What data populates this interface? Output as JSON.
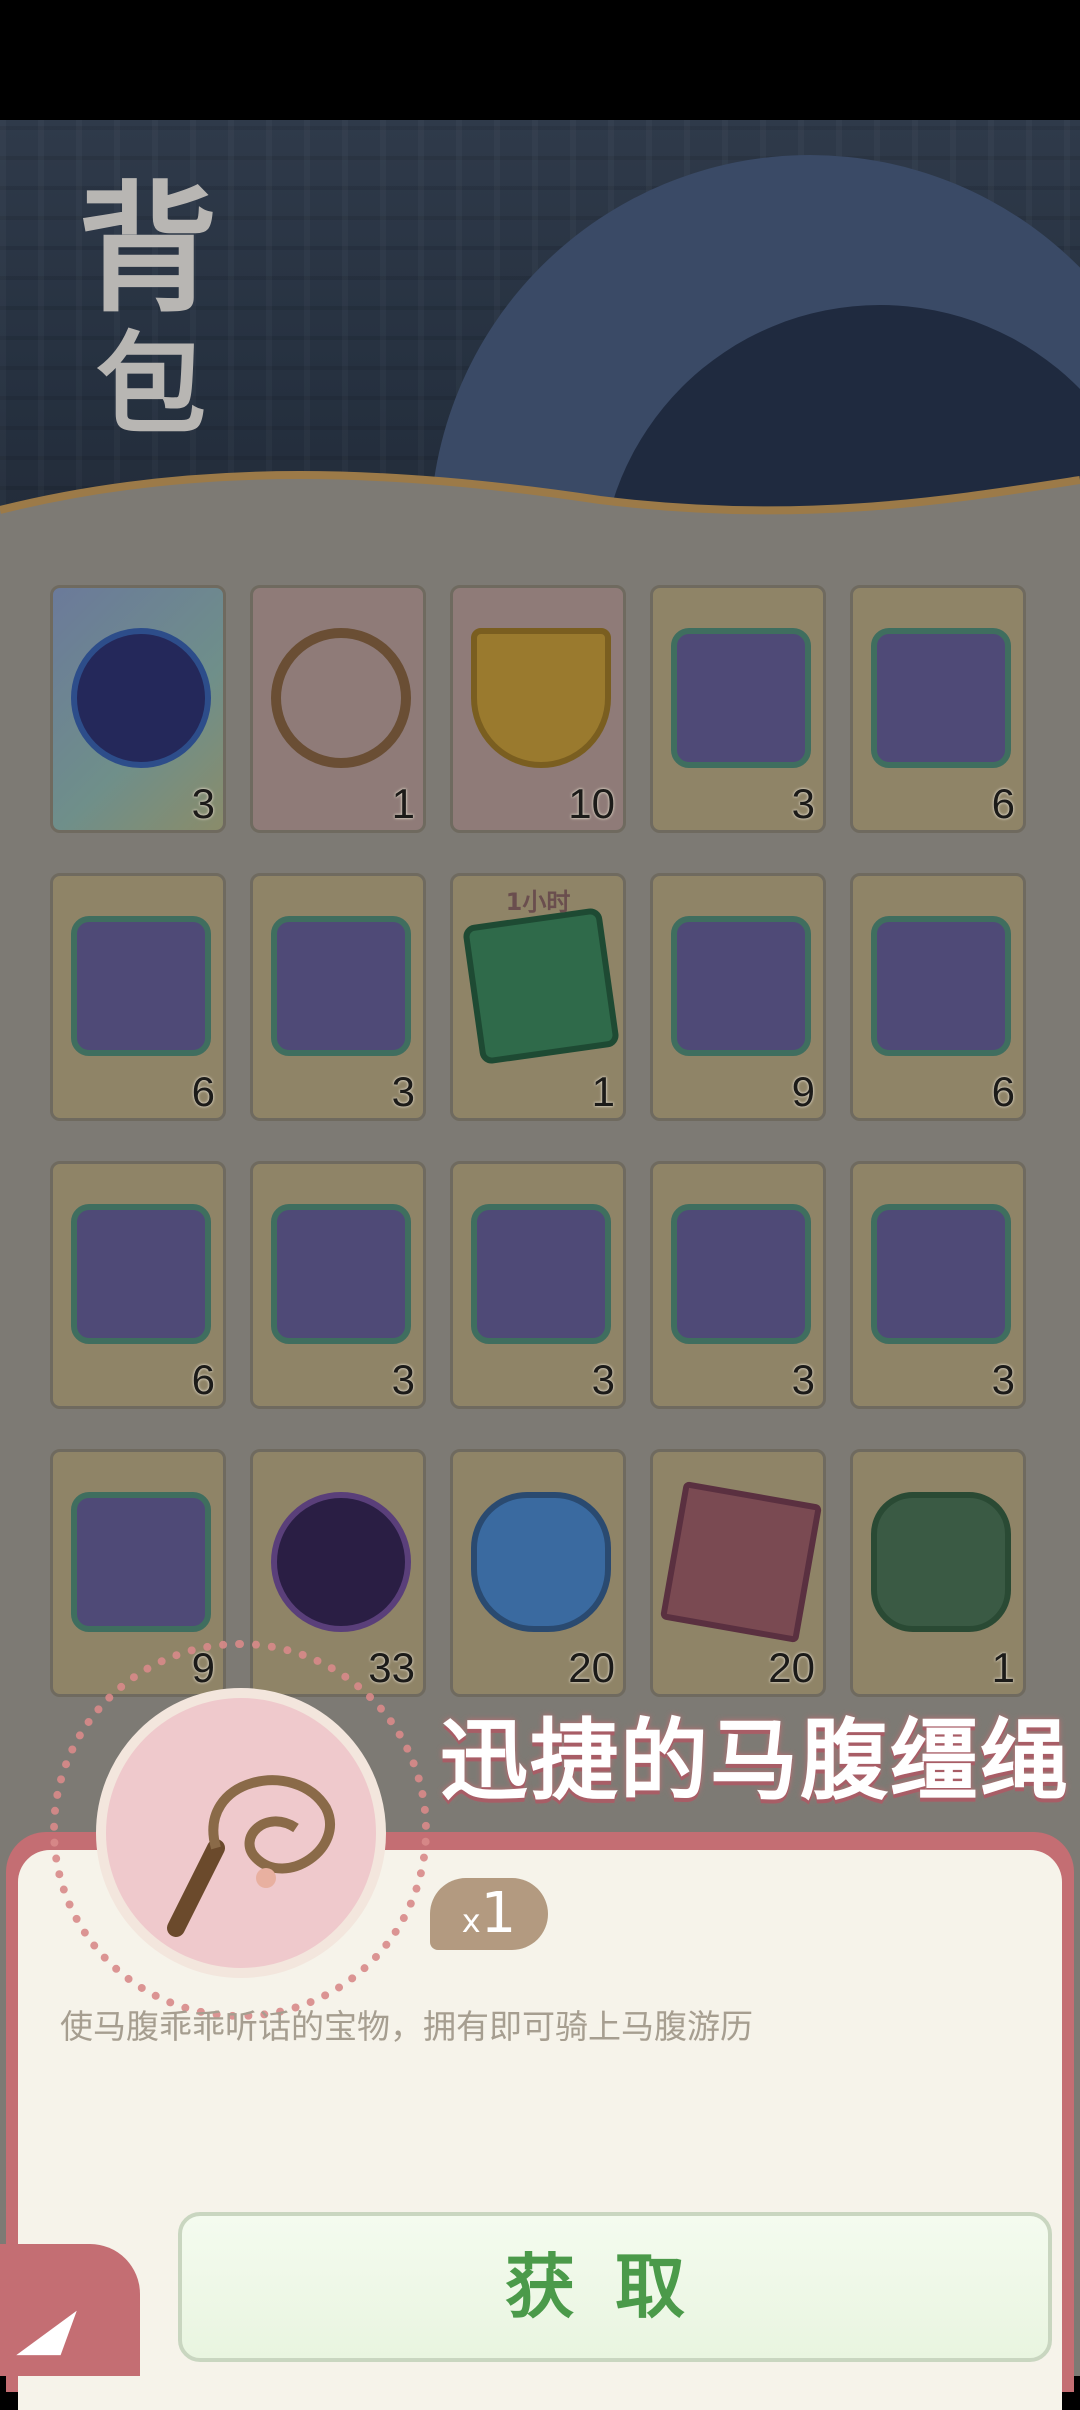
{
  "page": {
    "title_line1": "背",
    "title_line2": "包"
  },
  "inventory": [
    {
      "row": 0,
      "col": 0,
      "style": "blue",
      "icon": "orb-icon",
      "count": "3"
    },
    {
      "row": 0,
      "col": 1,
      "style": "pink",
      "icon": "whip-icon",
      "count": "1"
    },
    {
      "row": 0,
      "col": 2,
      "style": "pink",
      "icon": "gold-vessel-icon",
      "count": "10"
    },
    {
      "row": 0,
      "col": 3,
      "style": "gold",
      "icon": "puzzle-piece-icon",
      "count": "3"
    },
    {
      "row": 0,
      "col": 4,
      "style": "gold",
      "icon": "puzzle-piece-icon",
      "count": "6"
    },
    {
      "row": 1,
      "col": 0,
      "style": "gold",
      "icon": "puzzle-piece-icon",
      "count": "6"
    },
    {
      "row": 1,
      "col": 1,
      "style": "gold",
      "icon": "puzzle-piece-icon",
      "count": "3"
    },
    {
      "row": 1,
      "col": 2,
      "style": "gold",
      "icon": "music-card-icon",
      "count": "1",
      "tag": "1小时"
    },
    {
      "row": 1,
      "col": 3,
      "style": "gold",
      "icon": "puzzle-piece-icon",
      "count": "9"
    },
    {
      "row": 1,
      "col": 4,
      "style": "gold",
      "icon": "puzzle-piece-icon",
      "count": "6"
    },
    {
      "row": 2,
      "col": 0,
      "style": "gold",
      "icon": "puzzle-piece-icon",
      "count": "6"
    },
    {
      "row": 2,
      "col": 1,
      "style": "gold",
      "icon": "puzzle-piece-icon",
      "count": "3"
    },
    {
      "row": 2,
      "col": 2,
      "style": "gold",
      "icon": "puzzle-piece-icon",
      "count": "3"
    },
    {
      "row": 2,
      "col": 3,
      "style": "gold",
      "icon": "puzzle-piece-icon",
      "count": "3"
    },
    {
      "row": 2,
      "col": 4,
      "style": "gold",
      "icon": "puzzle-piece-icon",
      "count": "3"
    },
    {
      "row": 3,
      "col": 0,
      "style": "gold",
      "icon": "puzzle-piece-icon",
      "count": "9"
    },
    {
      "row": 3,
      "col": 1,
      "style": "gold",
      "icon": "dark-orb-icon",
      "count": "33"
    },
    {
      "row": 3,
      "col": 2,
      "style": "gold",
      "icon": "vase-icon",
      "count": "20"
    },
    {
      "row": 3,
      "col": 3,
      "style": "gold",
      "icon": "book-icon",
      "count": "20"
    },
    {
      "row": 3,
      "col": 4,
      "style": "gold",
      "icon": "rune-stone-icon",
      "count": "1"
    }
  ],
  "detail": {
    "name": "迅捷的马腹缰绳",
    "qty_prefix": "x",
    "qty": "1",
    "description": "使马腹乖乖听话的宝物，拥有即可骑上马腹游历",
    "get_button": "获取",
    "icon": "whip-icon"
  },
  "colors": {
    "accent": "#c46e73",
    "button_text": "#4b9a4a",
    "panel_bg": "#f6f3ea"
  },
  "back_icon": "back-icon"
}
